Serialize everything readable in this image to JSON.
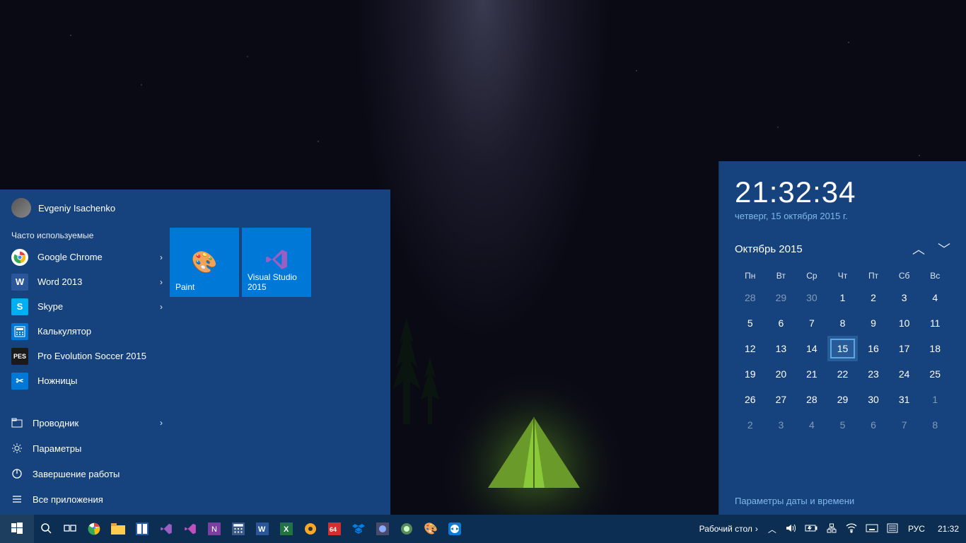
{
  "start_menu": {
    "user_name": "Evgeniy Isachenko",
    "frequent_label": "Часто используемые",
    "apps": [
      {
        "label": "Google Chrome",
        "icon": "chrome",
        "has_submenu": true
      },
      {
        "label": "Word 2013",
        "icon": "word",
        "has_submenu": true
      },
      {
        "label": "Skype",
        "icon": "skype",
        "has_submenu": true
      },
      {
        "label": "Калькулятор",
        "icon": "calculator",
        "has_submenu": false
      },
      {
        "label": "Pro Evolution Soccer 2015",
        "icon": "pes",
        "has_submenu": false
      },
      {
        "label": "Ножницы",
        "icon": "snipping",
        "has_submenu": false
      }
    ],
    "system_items": [
      {
        "label": "Проводник",
        "icon": "explorer",
        "has_submenu": true
      },
      {
        "label": "Параметры",
        "icon": "settings",
        "has_submenu": false
      },
      {
        "label": "Завершение работы",
        "icon": "power",
        "has_submenu": false
      },
      {
        "label": "Все приложения",
        "icon": "all-apps",
        "has_submenu": false
      }
    ],
    "tiles": [
      {
        "label": "Paint",
        "icon": "paint"
      },
      {
        "label": "Visual Studio 2015",
        "icon": "visual-studio"
      }
    ]
  },
  "calendar": {
    "clock_time": "21:32:34",
    "clock_date": "четверг, 15 октября 2015 г.",
    "month_label": "Октябрь 2015",
    "dow": [
      "Пн",
      "Вт",
      "Ср",
      "Чт",
      "Пт",
      "Сб",
      "Вс"
    ],
    "weeks": [
      [
        {
          "d": "28",
          "dim": true
        },
        {
          "d": "29",
          "dim": true
        },
        {
          "d": "30",
          "dim": true
        },
        {
          "d": "1"
        },
        {
          "d": "2"
        },
        {
          "d": "3"
        },
        {
          "d": "4"
        }
      ],
      [
        {
          "d": "5"
        },
        {
          "d": "6"
        },
        {
          "d": "7"
        },
        {
          "d": "8"
        },
        {
          "d": "9"
        },
        {
          "d": "10"
        },
        {
          "d": "11"
        }
      ],
      [
        {
          "d": "12"
        },
        {
          "d": "13"
        },
        {
          "d": "14"
        },
        {
          "d": "15",
          "today": true
        },
        {
          "d": "16"
        },
        {
          "d": "17"
        },
        {
          "d": "18"
        }
      ],
      [
        {
          "d": "19"
        },
        {
          "d": "20"
        },
        {
          "d": "21"
        },
        {
          "d": "22"
        },
        {
          "d": "23"
        },
        {
          "d": "24"
        },
        {
          "d": "25"
        }
      ],
      [
        {
          "d": "26"
        },
        {
          "d": "27"
        },
        {
          "d": "28"
        },
        {
          "d": "29"
        },
        {
          "d": "30"
        },
        {
          "d": "31"
        },
        {
          "d": "1",
          "dim": true
        }
      ],
      [
        {
          "d": "2",
          "dim": true
        },
        {
          "d": "3",
          "dim": true
        },
        {
          "d": "4",
          "dim": true
        },
        {
          "d": "5",
          "dim": true
        },
        {
          "d": "6",
          "dim": true
        },
        {
          "d": "7",
          "dim": true
        },
        {
          "d": "8",
          "dim": true
        }
      ]
    ],
    "settings_link": "Параметры даты и времени"
  },
  "taskbar": {
    "pinned": [
      "start",
      "search",
      "task-view",
      "chrome",
      "explorer",
      "total-commander",
      "visual-studio",
      "visual-studio-blend",
      "onenote",
      "calculator",
      "word",
      "excel",
      "media",
      "aida64",
      "dropbox",
      "app1",
      "app2",
      "paint",
      "teamviewer"
    ],
    "show_desktop_label": "Рабочий стол",
    "tray_icons": [
      "tray-chevron",
      "volume",
      "power",
      "network",
      "wifi",
      "ease-of-access",
      "input-method"
    ],
    "language": "РУС",
    "clock": "21:32"
  }
}
